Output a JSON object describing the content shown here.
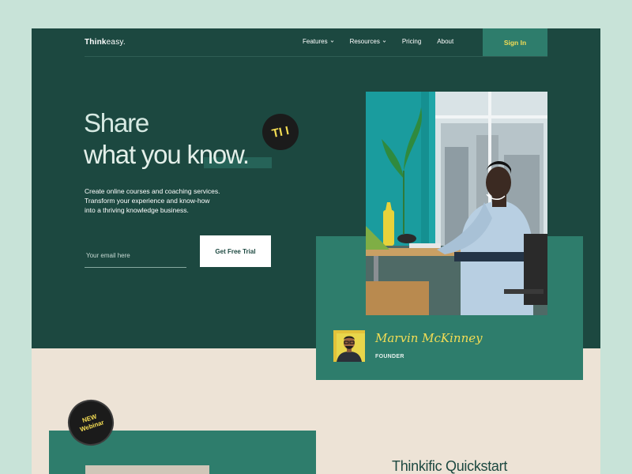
{
  "brand": {
    "name_bold": "Think",
    "name_light": "easy."
  },
  "nav": {
    "items": [
      {
        "label": "Features",
        "dropdown": true
      },
      {
        "label": "Resources",
        "dropdown": true
      },
      {
        "label": "Pricing",
        "dropdown": false
      },
      {
        "label": "About",
        "dropdown": false
      }
    ],
    "signin_label": "Sign In"
  },
  "hero": {
    "headline_line1": "Share",
    "headline_line2": "what you know.",
    "badge_text": "TI I",
    "subtext_lines": [
      "Create online courses and coaching services.",
      "Transform your experience and know-how",
      "into a thriving knowledge business."
    ],
    "email_placeholder": "Your email here",
    "cta_label": "Get Free Trial"
  },
  "founder": {
    "name": "Marvin McKinney",
    "role": "FOUNDER"
  },
  "webinar_badge": {
    "line1": "NEW",
    "line2": "Webinar"
  },
  "quickstart_title": "Thinkific Quickstart",
  "colors": {
    "bg": "#c8e3d8",
    "hero": "#1c4840",
    "accent_green": "#2e7d6c",
    "yellow": "#f4dd54",
    "cream": "#ede3d6"
  }
}
